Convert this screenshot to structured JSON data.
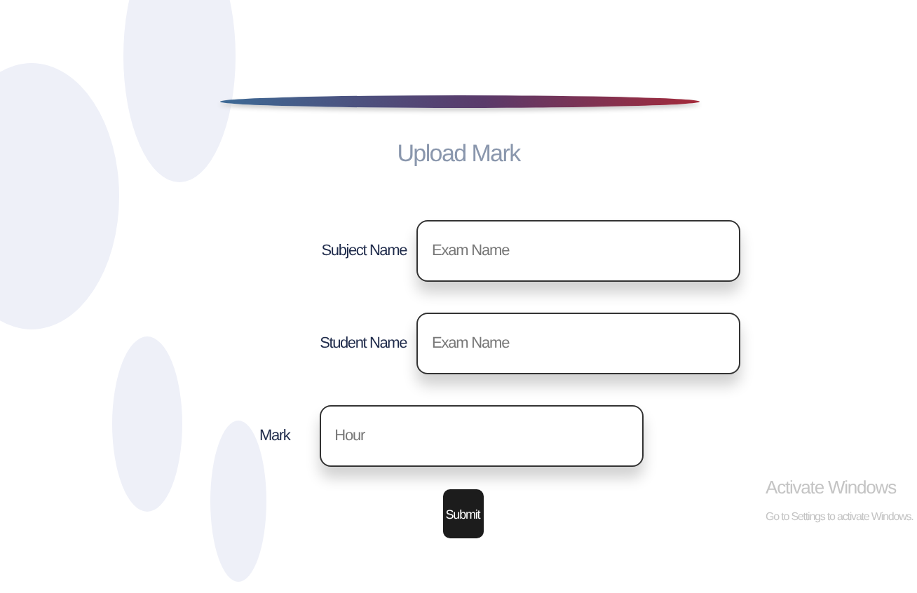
{
  "title": "Upload Mark",
  "fields": [
    {
      "label": "Subject Name",
      "placeholder": "Exam Name"
    },
    {
      "label": "Student Name",
      "placeholder": "Exam Name"
    },
    {
      "label": "Mark",
      "placeholder": "Hour"
    }
  ],
  "submit": "Submit",
  "os_notice": {
    "title": "Activate Windows",
    "subtitle": "Go to Settings to activate Windows."
  }
}
